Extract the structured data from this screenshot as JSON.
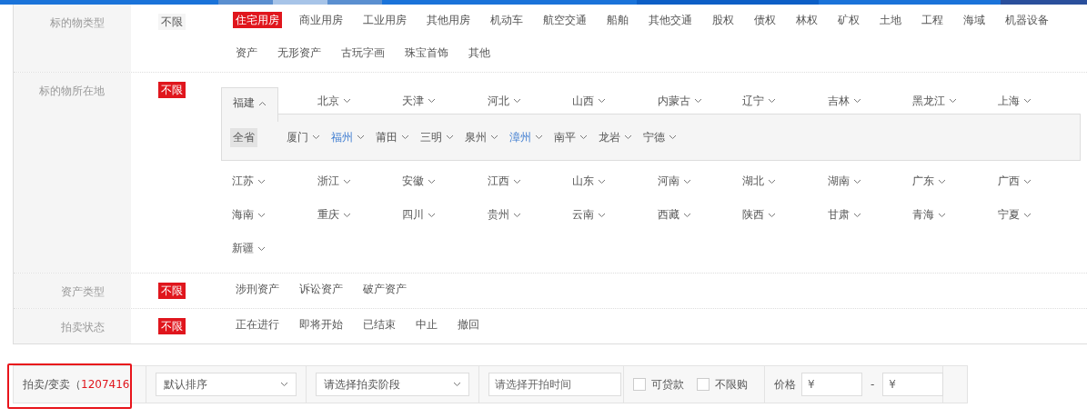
{
  "filters": [
    {
      "kind": "options",
      "label": "标的物类型",
      "all": {
        "text": "不限",
        "selected": false
      },
      "options": [
        {
          "text": "住宅用房",
          "selected": true
        },
        {
          "text": "商业用房",
          "selected": false
        },
        {
          "text": "工业用房",
          "selected": false
        },
        {
          "text": "其他用房",
          "selected": false
        },
        {
          "text": "机动车",
          "selected": false
        },
        {
          "text": "航空交通",
          "selected": false
        },
        {
          "text": "船舶",
          "selected": false
        },
        {
          "text": "其他交通",
          "selected": false
        },
        {
          "text": "股权",
          "selected": false
        },
        {
          "text": "债权",
          "selected": false
        },
        {
          "text": "林权",
          "selected": false
        },
        {
          "text": "矿权",
          "selected": false
        },
        {
          "text": "土地",
          "selected": false
        },
        {
          "text": "工程",
          "selected": false
        },
        {
          "text": "海域",
          "selected": false
        },
        {
          "text": "机器设备",
          "selected": false
        },
        {
          "text": "资产",
          "selected": false
        },
        {
          "text": "无形资产",
          "selected": false
        },
        {
          "text": "古玩字画",
          "selected": false
        },
        {
          "text": "珠宝首饰",
          "selected": false
        },
        {
          "text": "其他",
          "selected": false
        }
      ]
    },
    {
      "kind": "region",
      "label": "标的物所在地",
      "all": {
        "text": "不限",
        "selected": true
      },
      "provinces": [
        {
          "text": "福建",
          "expanded": true,
          "all_text": "全省",
          "cities": [
            {
              "text": "厦门",
              "visited": false
            },
            {
              "text": "福州",
              "visited": true
            },
            {
              "text": "莆田",
              "visited": false
            },
            {
              "text": "三明",
              "visited": false
            },
            {
              "text": "泉州",
              "visited": false
            },
            {
              "text": "漳州",
              "visited": true
            },
            {
              "text": "南平",
              "visited": false
            },
            {
              "text": "龙岩",
              "visited": false
            },
            {
              "text": "宁德",
              "visited": false
            }
          ]
        },
        {
          "text": "北京",
          "expanded": false
        },
        {
          "text": "天津",
          "expanded": false
        },
        {
          "text": "河北",
          "expanded": false
        },
        {
          "text": "山西",
          "expanded": false
        },
        {
          "text": "内蒙古",
          "expanded": false
        },
        {
          "text": "辽宁",
          "expanded": false
        },
        {
          "text": "吉林",
          "expanded": false
        },
        {
          "text": "黑龙江",
          "expanded": false
        },
        {
          "text": "上海",
          "expanded": false
        },
        {
          "text": "江苏",
          "expanded": false
        },
        {
          "text": "浙江",
          "expanded": false
        },
        {
          "text": "安徽",
          "expanded": false
        },
        {
          "text": "江西",
          "expanded": false
        },
        {
          "text": "山东",
          "expanded": false
        },
        {
          "text": "河南",
          "expanded": false
        },
        {
          "text": "湖北",
          "expanded": false
        },
        {
          "text": "湖南",
          "expanded": false
        },
        {
          "text": "广东",
          "expanded": false
        },
        {
          "text": "广西",
          "expanded": false
        },
        {
          "text": "海南",
          "expanded": false
        },
        {
          "text": "重庆",
          "expanded": false
        },
        {
          "text": "四川",
          "expanded": false
        },
        {
          "text": "贵州",
          "expanded": false
        },
        {
          "text": "云南",
          "expanded": false
        },
        {
          "text": "西藏",
          "expanded": false
        },
        {
          "text": "陕西",
          "expanded": false
        },
        {
          "text": "甘肃",
          "expanded": false
        },
        {
          "text": "青海",
          "expanded": false
        },
        {
          "text": "宁夏",
          "expanded": false
        },
        {
          "text": "新疆",
          "expanded": false
        }
      ]
    },
    {
      "kind": "options",
      "label": "资产类型",
      "all": {
        "text": "不限",
        "selected": true
      },
      "options": [
        {
          "text": "涉刑资产",
          "selected": false
        },
        {
          "text": "诉讼资产",
          "selected": false
        },
        {
          "text": "破产资产",
          "selected": false
        }
      ]
    },
    {
      "kind": "options",
      "label": "拍卖状态",
      "all": {
        "text": "不限",
        "selected": true
      },
      "options": [
        {
          "text": "正在进行",
          "selected": false
        },
        {
          "text": "即将开始",
          "selected": false
        },
        {
          "text": "已结束",
          "selected": false
        },
        {
          "text": "中止",
          "selected": false
        },
        {
          "text": "撤回",
          "selected": false
        }
      ]
    }
  ],
  "toolbar": {
    "count_label": "拍卖/变卖（",
    "count": "1207416",
    "highlighted": true,
    "sort_select": {
      "value": "默认排序"
    },
    "stage_select": {
      "placeholder": "请选择拍卖阶段"
    },
    "time_field": {
      "placeholder": "请选择开拍时间"
    },
    "checkboxes": [
      {
        "label": "可贷款",
        "checked": false
      },
      {
        "label": "不限购",
        "checked": false
      }
    ],
    "price_label": "价格",
    "price_min": {
      "placeholder": "¥"
    },
    "separator": "-",
    "price_max": {
      "placeholder": "¥"
    }
  }
}
